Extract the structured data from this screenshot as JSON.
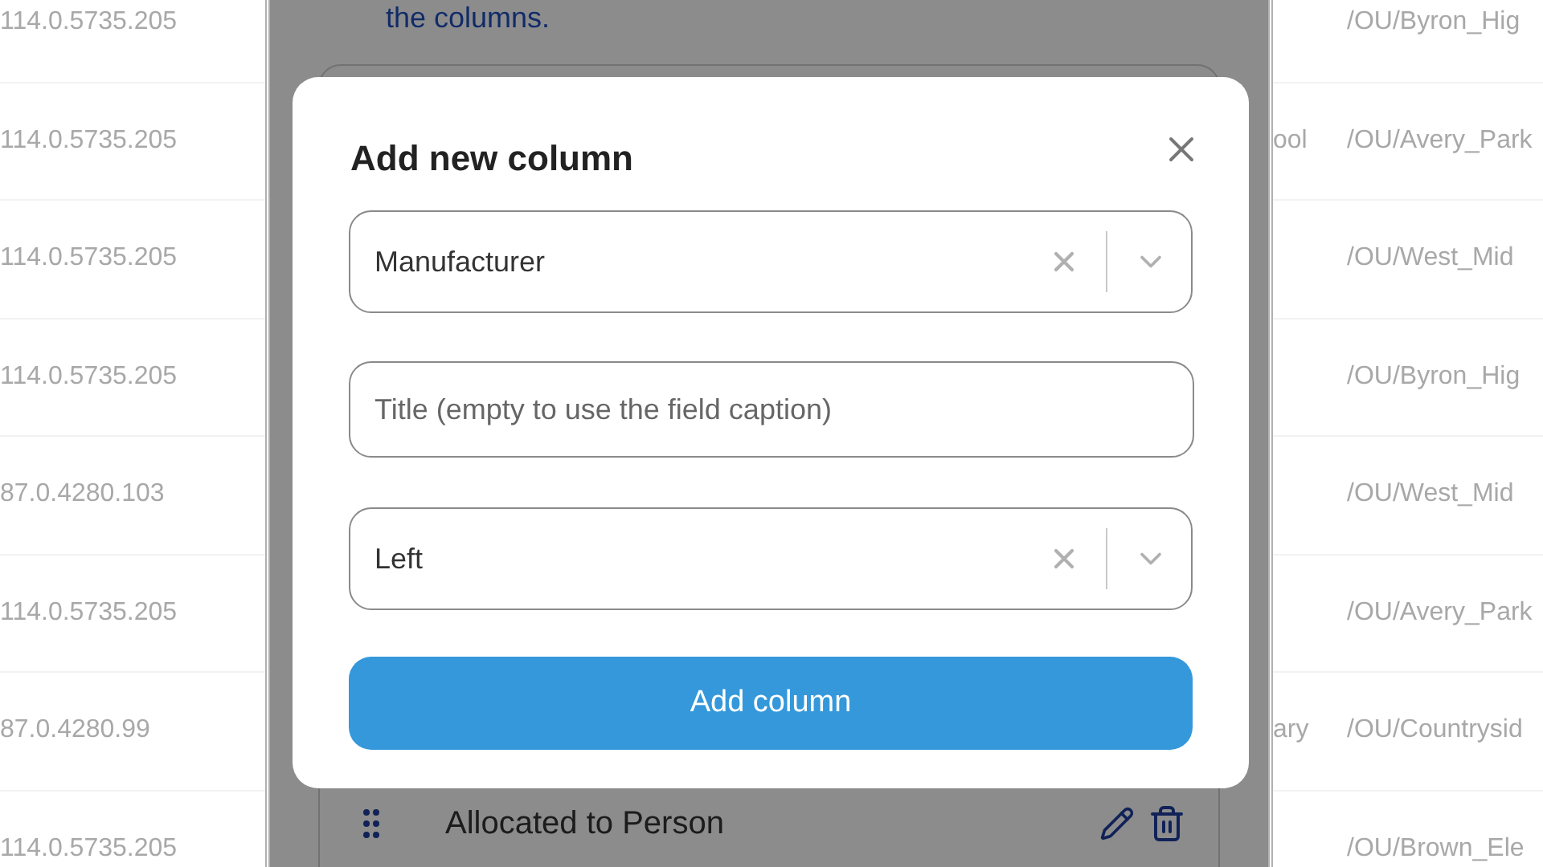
{
  "background_table": {
    "rows": [
      {
        "column_1": "114.0.5735.205",
        "column_3": "/OU/Byron_Hig"
      },
      {
        "column_1": "114.0.5735.205",
        "column_2": "ool",
        "column_3": "/OU/Avery_Park"
      },
      {
        "column_1": "114.0.5735.205",
        "column_3": "/OU/West_Mid"
      },
      {
        "column_1": "114.0.5735.205",
        "column_3": "/OU/Byron_Hig"
      },
      {
        "column_1": "87.0.4280.103",
        "column_3": "/OU/West_Mid"
      },
      {
        "column_1": "114.0.5735.205",
        "column_3": "/OU/Avery_Park"
      },
      {
        "column_1": "87.0.4280.99",
        "column_2": "ary",
        "column_3": "/OU/Countrysid"
      },
      {
        "column_1": "114.0.5735.205",
        "column_3": "/OU/Brown_Ele"
      }
    ]
  },
  "panel": {
    "intro_text": "the columns.",
    "columns_list": [
      {
        "label": "Allocated to Person"
      }
    ]
  },
  "dialog": {
    "title": "Add new column",
    "field_select": {
      "value": "Manufacturer"
    },
    "title_input": {
      "placeholder": "Title (empty to use the field caption)"
    },
    "alignment_select": {
      "value": "Left"
    },
    "submit_button": "Add column"
  }
}
